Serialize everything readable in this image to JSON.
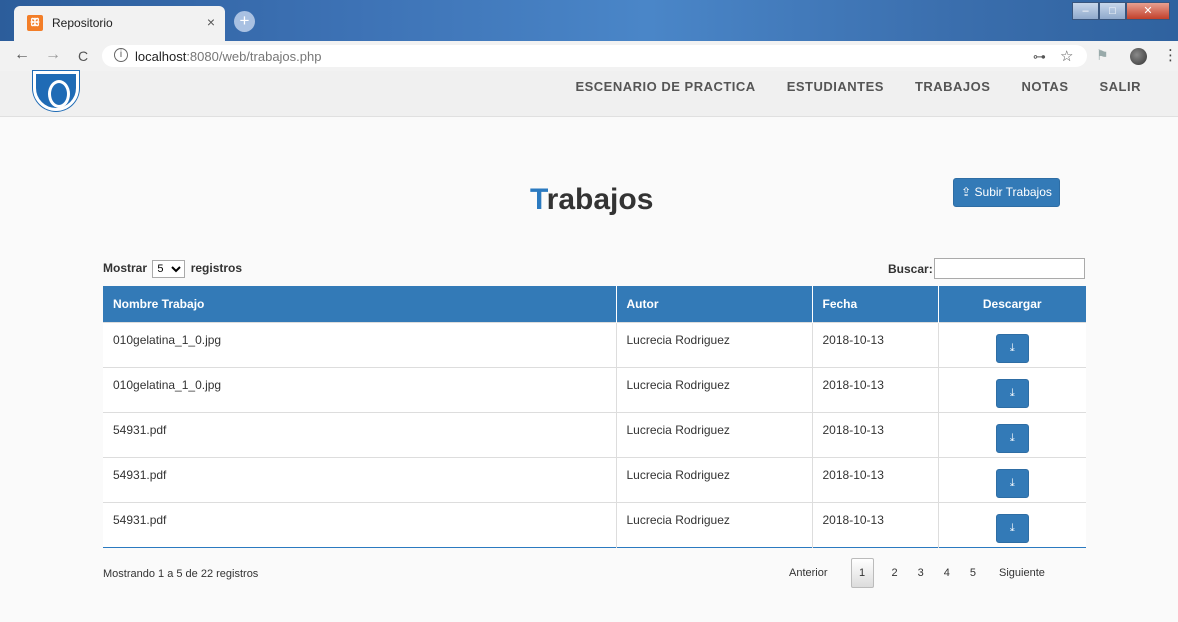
{
  "browser": {
    "tab_title": "Repositorio",
    "favicon_glyph": "ꕥ",
    "close_glyph": "×",
    "newtab_glyph": "+",
    "url_host": "localhost",
    "url_rest": ":8080/web/trabajos.php",
    "info_glyph": "i",
    "back_glyph": "←",
    "forward_glyph": "→",
    "reload_glyph": "C",
    "key_glyph": "⊶",
    "star_glyph": "☆",
    "ext_glyph": "⚑",
    "menu_glyph": "⋮",
    "win_min": "–",
    "win_max": "□",
    "win_close": "✕"
  },
  "nav": {
    "items": [
      "ESCENARIO DE PRACTICA",
      "ESTUDIANTES",
      "TRABAJOS",
      "NOTAS",
      "SALIR"
    ]
  },
  "page": {
    "title_first": "T",
    "title_rest": "rabajos",
    "upload_icon": "⇪",
    "upload_label": "Subir Trabajos"
  },
  "table_controls": {
    "show_label": "Mostrar",
    "page_size": "5",
    "records_label": "registros",
    "search_label": "Buscar:",
    "search_value": ""
  },
  "table": {
    "headers": [
      "Nombre Trabajo",
      "Autor",
      "Fecha",
      "Descargar"
    ],
    "download_glyph": "⤓",
    "rows": [
      [
        "010gelatina_1_0.jpg",
        "Lucrecia Rodriguez",
        "2018-10-13"
      ],
      [
        "010gelatina_1_0.jpg",
        "Lucrecia Rodriguez",
        "2018-10-13"
      ],
      [
        "54931.pdf",
        "Lucrecia Rodriguez",
        "2018-10-13"
      ],
      [
        "54931.pdf",
        "Lucrecia Rodriguez",
        "2018-10-13"
      ],
      [
        "54931.pdf",
        "Lucrecia Rodriguez",
        "2018-10-13"
      ]
    ]
  },
  "pagination": {
    "info": "Mostrando 1 a 5 de 22 registros",
    "previous": "Anterior",
    "pages": [
      "1",
      "2",
      "3",
      "4",
      "5"
    ],
    "current": "1",
    "next": "Siguiente"
  },
  "colors": {
    "accent": "#337ab7",
    "title_accent": "#2b7ac0"
  }
}
